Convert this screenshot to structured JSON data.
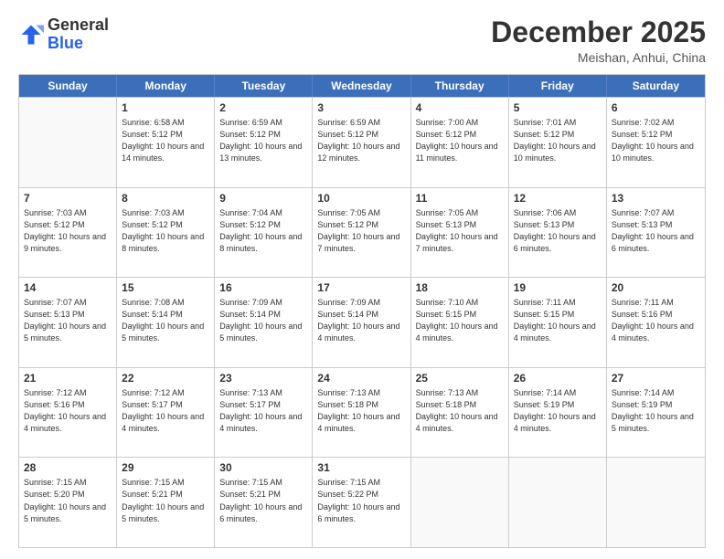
{
  "header": {
    "logo_general": "General",
    "logo_blue": "Blue",
    "month_title": "December 2025",
    "location": "Meishan, Anhui, China"
  },
  "weekdays": [
    "Sunday",
    "Monday",
    "Tuesday",
    "Wednesday",
    "Thursday",
    "Friday",
    "Saturday"
  ],
  "weeks": [
    [
      {
        "day": "",
        "sunrise": "",
        "sunset": "",
        "daylight": ""
      },
      {
        "day": "1",
        "sunrise": "Sunrise: 6:58 AM",
        "sunset": "Sunset: 5:12 PM",
        "daylight": "Daylight: 10 hours and 14 minutes."
      },
      {
        "day": "2",
        "sunrise": "Sunrise: 6:59 AM",
        "sunset": "Sunset: 5:12 PM",
        "daylight": "Daylight: 10 hours and 13 minutes."
      },
      {
        "day": "3",
        "sunrise": "Sunrise: 6:59 AM",
        "sunset": "Sunset: 5:12 PM",
        "daylight": "Daylight: 10 hours and 12 minutes."
      },
      {
        "day": "4",
        "sunrise": "Sunrise: 7:00 AM",
        "sunset": "Sunset: 5:12 PM",
        "daylight": "Daylight: 10 hours and 11 minutes."
      },
      {
        "day": "5",
        "sunrise": "Sunrise: 7:01 AM",
        "sunset": "Sunset: 5:12 PM",
        "daylight": "Daylight: 10 hours and 10 minutes."
      },
      {
        "day": "6",
        "sunrise": "Sunrise: 7:02 AM",
        "sunset": "Sunset: 5:12 PM",
        "daylight": "Daylight: 10 hours and 10 minutes."
      }
    ],
    [
      {
        "day": "7",
        "sunrise": "Sunrise: 7:03 AM",
        "sunset": "Sunset: 5:12 PM",
        "daylight": "Daylight: 10 hours and 9 minutes."
      },
      {
        "day": "8",
        "sunrise": "Sunrise: 7:03 AM",
        "sunset": "Sunset: 5:12 PM",
        "daylight": "Daylight: 10 hours and 8 minutes."
      },
      {
        "day": "9",
        "sunrise": "Sunrise: 7:04 AM",
        "sunset": "Sunset: 5:12 PM",
        "daylight": "Daylight: 10 hours and 8 minutes."
      },
      {
        "day": "10",
        "sunrise": "Sunrise: 7:05 AM",
        "sunset": "Sunset: 5:12 PM",
        "daylight": "Daylight: 10 hours and 7 minutes."
      },
      {
        "day": "11",
        "sunrise": "Sunrise: 7:05 AM",
        "sunset": "Sunset: 5:13 PM",
        "daylight": "Daylight: 10 hours and 7 minutes."
      },
      {
        "day": "12",
        "sunrise": "Sunrise: 7:06 AM",
        "sunset": "Sunset: 5:13 PM",
        "daylight": "Daylight: 10 hours and 6 minutes."
      },
      {
        "day": "13",
        "sunrise": "Sunrise: 7:07 AM",
        "sunset": "Sunset: 5:13 PM",
        "daylight": "Daylight: 10 hours and 6 minutes."
      }
    ],
    [
      {
        "day": "14",
        "sunrise": "Sunrise: 7:07 AM",
        "sunset": "Sunset: 5:13 PM",
        "daylight": "Daylight: 10 hours and 5 minutes."
      },
      {
        "day": "15",
        "sunrise": "Sunrise: 7:08 AM",
        "sunset": "Sunset: 5:14 PM",
        "daylight": "Daylight: 10 hours and 5 minutes."
      },
      {
        "day": "16",
        "sunrise": "Sunrise: 7:09 AM",
        "sunset": "Sunset: 5:14 PM",
        "daylight": "Daylight: 10 hours and 5 minutes."
      },
      {
        "day": "17",
        "sunrise": "Sunrise: 7:09 AM",
        "sunset": "Sunset: 5:14 PM",
        "daylight": "Daylight: 10 hours and 4 minutes."
      },
      {
        "day": "18",
        "sunrise": "Sunrise: 7:10 AM",
        "sunset": "Sunset: 5:15 PM",
        "daylight": "Daylight: 10 hours and 4 minutes."
      },
      {
        "day": "19",
        "sunrise": "Sunrise: 7:11 AM",
        "sunset": "Sunset: 5:15 PM",
        "daylight": "Daylight: 10 hours and 4 minutes."
      },
      {
        "day": "20",
        "sunrise": "Sunrise: 7:11 AM",
        "sunset": "Sunset: 5:16 PM",
        "daylight": "Daylight: 10 hours and 4 minutes."
      }
    ],
    [
      {
        "day": "21",
        "sunrise": "Sunrise: 7:12 AM",
        "sunset": "Sunset: 5:16 PM",
        "daylight": "Daylight: 10 hours and 4 minutes."
      },
      {
        "day": "22",
        "sunrise": "Sunrise: 7:12 AM",
        "sunset": "Sunset: 5:17 PM",
        "daylight": "Daylight: 10 hours and 4 minutes."
      },
      {
        "day": "23",
        "sunrise": "Sunrise: 7:13 AM",
        "sunset": "Sunset: 5:17 PM",
        "daylight": "Daylight: 10 hours and 4 minutes."
      },
      {
        "day": "24",
        "sunrise": "Sunrise: 7:13 AM",
        "sunset": "Sunset: 5:18 PM",
        "daylight": "Daylight: 10 hours and 4 minutes."
      },
      {
        "day": "25",
        "sunrise": "Sunrise: 7:13 AM",
        "sunset": "Sunset: 5:18 PM",
        "daylight": "Daylight: 10 hours and 4 minutes."
      },
      {
        "day": "26",
        "sunrise": "Sunrise: 7:14 AM",
        "sunset": "Sunset: 5:19 PM",
        "daylight": "Daylight: 10 hours and 4 minutes."
      },
      {
        "day": "27",
        "sunrise": "Sunrise: 7:14 AM",
        "sunset": "Sunset: 5:19 PM",
        "daylight": "Daylight: 10 hours and 5 minutes."
      }
    ],
    [
      {
        "day": "28",
        "sunrise": "Sunrise: 7:15 AM",
        "sunset": "Sunset: 5:20 PM",
        "daylight": "Daylight: 10 hours and 5 minutes."
      },
      {
        "day": "29",
        "sunrise": "Sunrise: 7:15 AM",
        "sunset": "Sunset: 5:21 PM",
        "daylight": "Daylight: 10 hours and 5 minutes."
      },
      {
        "day": "30",
        "sunrise": "Sunrise: 7:15 AM",
        "sunset": "Sunset: 5:21 PM",
        "daylight": "Daylight: 10 hours and 6 minutes."
      },
      {
        "day": "31",
        "sunrise": "Sunrise: 7:15 AM",
        "sunset": "Sunset: 5:22 PM",
        "daylight": "Daylight: 10 hours and 6 minutes."
      },
      {
        "day": "",
        "sunrise": "",
        "sunset": "",
        "daylight": ""
      },
      {
        "day": "",
        "sunrise": "",
        "sunset": "",
        "daylight": ""
      },
      {
        "day": "",
        "sunrise": "",
        "sunset": "",
        "daylight": ""
      }
    ]
  ]
}
